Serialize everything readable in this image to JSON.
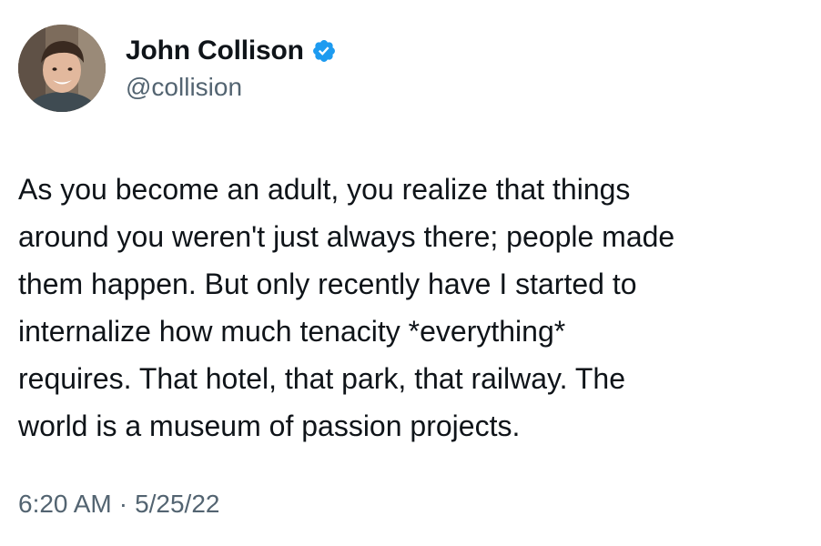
{
  "author": {
    "display_name": "John Collison",
    "handle": "@collision",
    "verified": true,
    "avatar_icon": "profile-photo"
  },
  "tweet": {
    "lines": [
      "As you become an adult, you realize that things",
      "around you weren't just always there; people made",
      "them happen. But only recently have I started to",
      "internalize how much tenacity *everything*",
      "requires. That hotel, that park, that railway. The",
      "world is a museum of passion projects."
    ]
  },
  "meta": {
    "time": "6:20 AM",
    "separator": "·",
    "date": "5/25/22"
  },
  "colors": {
    "text": "#0f1419",
    "secondary": "#536471",
    "verified": "#1d9bf0"
  }
}
